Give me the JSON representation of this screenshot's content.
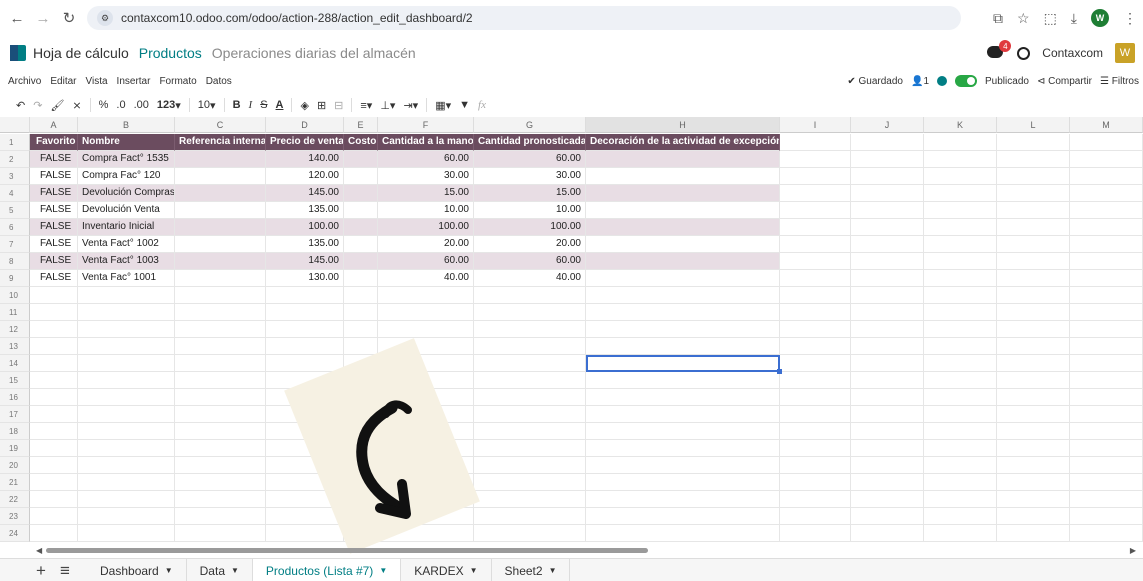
{
  "browser": {
    "url": "contaxcom10.odoo.com/odoo/action-288/action_edit_dashboard/2",
    "profile_initial": "W"
  },
  "odoo": {
    "breadcrumb_root": "Hoja de cálculo",
    "breadcrumb_active": "Productos",
    "breadcrumb_sub": "Operaciones diarias del almacén",
    "chat_badge": "4",
    "company": "Contaxcom",
    "user_initial": "W"
  },
  "menubar": {
    "items": [
      "Archivo",
      "Editar",
      "Vista",
      "Insertar",
      "Formato",
      "Datos"
    ],
    "saved": "✔ Guardado",
    "collaborators": "1",
    "published": "Publicado",
    "share": "Compartir",
    "filters": "Filtros"
  },
  "toolbar": {
    "percent": "%",
    "dec_less": ".0",
    "dec_more": ".00",
    "number_format": "123",
    "font_size": "10",
    "fx": "fx"
  },
  "grid": {
    "columns": [
      "A",
      "B",
      "C",
      "D",
      "E",
      "F",
      "G",
      "H",
      "I",
      "J",
      "K",
      "L",
      "M"
    ],
    "rows": [
      "1",
      "2",
      "3",
      "4",
      "5",
      "6",
      "7",
      "8",
      "9",
      "10",
      "11",
      "12",
      "13",
      "14",
      "15",
      "16",
      "17",
      "18",
      "19",
      "20",
      "21",
      "22",
      "23",
      "24"
    ],
    "headers": [
      "Favorito",
      "Nombre",
      "Referencia interna",
      "Precio de venta",
      "Costo",
      "Cantidad a la mano",
      "Cantidad pronosticada",
      "Decoración de la actividad de excepción"
    ],
    "data": [
      [
        "FALSE",
        "Compra Fact° 1535",
        "",
        "140.00",
        "",
        "60.00",
        "60.00",
        ""
      ],
      [
        "FALSE",
        "Compra Fac° 120",
        "",
        "120.00",
        "",
        "30.00",
        "30.00",
        ""
      ],
      [
        "FALSE",
        "Devolución Compras",
        "",
        "145.00",
        "",
        "15.00",
        "15.00",
        ""
      ],
      [
        "FALSE",
        "Devolución Venta",
        "",
        "135.00",
        "",
        "10.00",
        "10.00",
        ""
      ],
      [
        "FALSE",
        "Inventario Inicial",
        "",
        "100.00",
        "",
        "100.00",
        "100.00",
        ""
      ],
      [
        "FALSE",
        "Venta Fact° 1002",
        "",
        "135.00",
        "",
        "20.00",
        "20.00",
        ""
      ],
      [
        "FALSE",
        "Venta Fact° 1003",
        "",
        "145.00",
        "",
        "60.00",
        "60.00",
        ""
      ],
      [
        "FALSE",
        "Venta Fac° 1001",
        "",
        "130.00",
        "",
        "40.00",
        "40.00",
        ""
      ]
    ]
  },
  "sheets": [
    {
      "label": "Dashboard"
    },
    {
      "label": "Data"
    },
    {
      "label": "Productos (Lista #7)"
    },
    {
      "label": "KARDEX"
    },
    {
      "label": "Sheet2"
    }
  ],
  "colors": {
    "header_row": "#6b4c5f",
    "band_row": "#e8dde4",
    "accent": "#017e84",
    "selection": "#3b6ed1"
  }
}
